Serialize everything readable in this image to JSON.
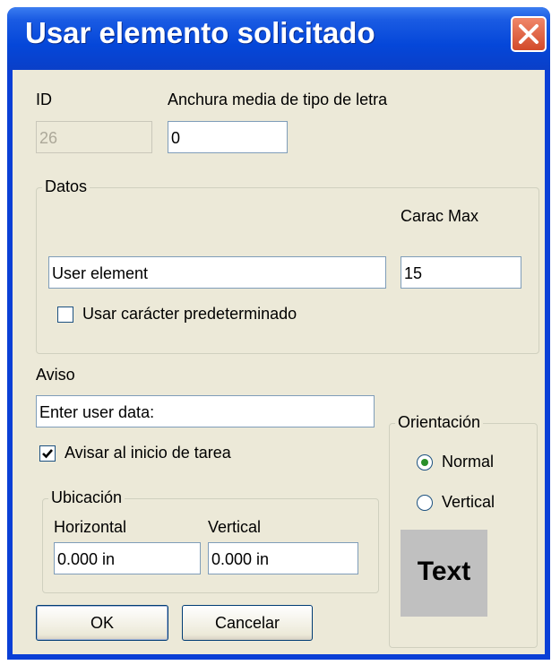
{
  "dialog": {
    "title": "Usar elemento solicitado"
  },
  "id": {
    "label": "ID",
    "value": "26"
  },
  "font_width": {
    "label": "Anchura media de tipo de letra",
    "value": "0"
  },
  "datos": {
    "legend": "Datos",
    "max_chars_label": "Carac Max",
    "data_value": "User element",
    "max_chars_value": "15",
    "default_char_label": "Usar carácter predeterminado",
    "default_char_checked": false
  },
  "aviso": {
    "label": "Aviso",
    "value": "Enter user data:",
    "prompt_at_start_label": "Avisar al inicio de tarea",
    "prompt_at_start_checked": true
  },
  "ubicacion": {
    "legend": "Ubicación",
    "horizontal_label": "Horizontal",
    "vertical_label": "Vertical",
    "horizontal_value": "0.000 in",
    "vertical_value": "0.000 in"
  },
  "orientacion": {
    "legend": "Orientación",
    "normal_label": "Normal",
    "vertical_label": "Vertical",
    "selected": "Normal"
  },
  "preview": {
    "text": "Text"
  },
  "buttons": {
    "ok": "OK",
    "cancel": "Cancelar"
  },
  "icons": {
    "close": "close-icon",
    "check": "checkmark-icon"
  },
  "colors": {
    "titlebar": "#0547d9",
    "close_button": "#d24a2a",
    "dialog_bg": "#ece9d8",
    "radio_dot": "#2a8f2a"
  }
}
